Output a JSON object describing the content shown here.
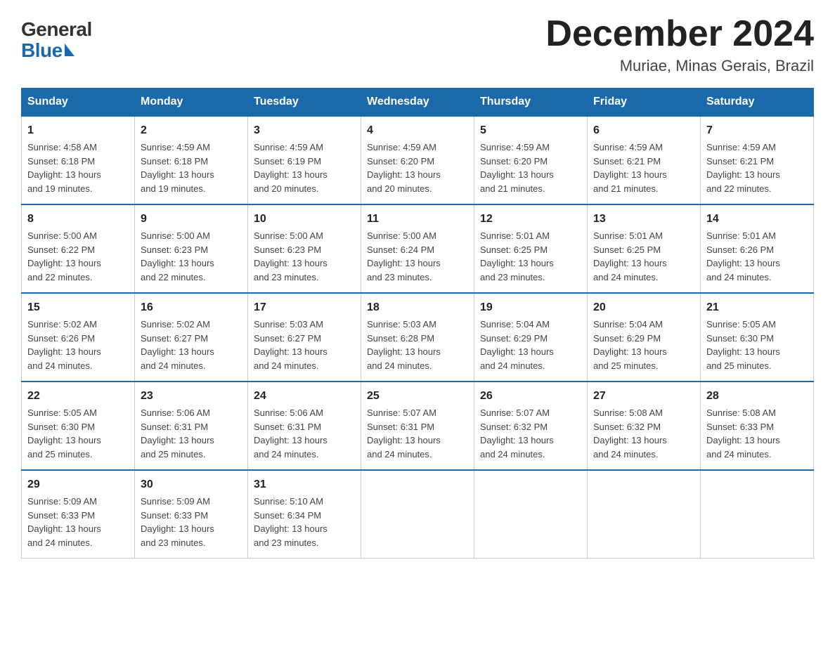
{
  "logo": {
    "general": "General",
    "blue": "Blue"
  },
  "title": "December 2024",
  "subtitle": "Muriae, Minas Gerais, Brazil",
  "days_of_week": [
    "Sunday",
    "Monday",
    "Tuesday",
    "Wednesday",
    "Thursday",
    "Friday",
    "Saturday"
  ],
  "weeks": [
    [
      {
        "day": "1",
        "sunrise": "4:58 AM",
        "sunset": "6:18 PM",
        "daylight": "13 hours and 19 minutes."
      },
      {
        "day": "2",
        "sunrise": "4:59 AM",
        "sunset": "6:18 PM",
        "daylight": "13 hours and 19 minutes."
      },
      {
        "day": "3",
        "sunrise": "4:59 AM",
        "sunset": "6:19 PM",
        "daylight": "13 hours and 20 minutes."
      },
      {
        "day": "4",
        "sunrise": "4:59 AM",
        "sunset": "6:20 PM",
        "daylight": "13 hours and 20 minutes."
      },
      {
        "day": "5",
        "sunrise": "4:59 AM",
        "sunset": "6:20 PM",
        "daylight": "13 hours and 21 minutes."
      },
      {
        "day": "6",
        "sunrise": "4:59 AM",
        "sunset": "6:21 PM",
        "daylight": "13 hours and 21 minutes."
      },
      {
        "day": "7",
        "sunrise": "4:59 AM",
        "sunset": "6:21 PM",
        "daylight": "13 hours and 22 minutes."
      }
    ],
    [
      {
        "day": "8",
        "sunrise": "5:00 AM",
        "sunset": "6:22 PM",
        "daylight": "13 hours and 22 minutes."
      },
      {
        "day": "9",
        "sunrise": "5:00 AM",
        "sunset": "6:23 PM",
        "daylight": "13 hours and 22 minutes."
      },
      {
        "day": "10",
        "sunrise": "5:00 AM",
        "sunset": "6:23 PM",
        "daylight": "13 hours and 23 minutes."
      },
      {
        "day": "11",
        "sunrise": "5:00 AM",
        "sunset": "6:24 PM",
        "daylight": "13 hours and 23 minutes."
      },
      {
        "day": "12",
        "sunrise": "5:01 AM",
        "sunset": "6:25 PM",
        "daylight": "13 hours and 23 minutes."
      },
      {
        "day": "13",
        "sunrise": "5:01 AM",
        "sunset": "6:25 PM",
        "daylight": "13 hours and 24 minutes."
      },
      {
        "day": "14",
        "sunrise": "5:01 AM",
        "sunset": "6:26 PM",
        "daylight": "13 hours and 24 minutes."
      }
    ],
    [
      {
        "day": "15",
        "sunrise": "5:02 AM",
        "sunset": "6:26 PM",
        "daylight": "13 hours and 24 minutes."
      },
      {
        "day": "16",
        "sunrise": "5:02 AM",
        "sunset": "6:27 PM",
        "daylight": "13 hours and 24 minutes."
      },
      {
        "day": "17",
        "sunrise": "5:03 AM",
        "sunset": "6:27 PM",
        "daylight": "13 hours and 24 minutes."
      },
      {
        "day": "18",
        "sunrise": "5:03 AM",
        "sunset": "6:28 PM",
        "daylight": "13 hours and 24 minutes."
      },
      {
        "day": "19",
        "sunrise": "5:04 AM",
        "sunset": "6:29 PM",
        "daylight": "13 hours and 24 minutes."
      },
      {
        "day": "20",
        "sunrise": "5:04 AM",
        "sunset": "6:29 PM",
        "daylight": "13 hours and 25 minutes."
      },
      {
        "day": "21",
        "sunrise": "5:05 AM",
        "sunset": "6:30 PM",
        "daylight": "13 hours and 25 minutes."
      }
    ],
    [
      {
        "day": "22",
        "sunrise": "5:05 AM",
        "sunset": "6:30 PM",
        "daylight": "13 hours and 25 minutes."
      },
      {
        "day": "23",
        "sunrise": "5:06 AM",
        "sunset": "6:31 PM",
        "daylight": "13 hours and 25 minutes."
      },
      {
        "day": "24",
        "sunrise": "5:06 AM",
        "sunset": "6:31 PM",
        "daylight": "13 hours and 24 minutes."
      },
      {
        "day": "25",
        "sunrise": "5:07 AM",
        "sunset": "6:31 PM",
        "daylight": "13 hours and 24 minutes."
      },
      {
        "day": "26",
        "sunrise": "5:07 AM",
        "sunset": "6:32 PM",
        "daylight": "13 hours and 24 minutes."
      },
      {
        "day": "27",
        "sunrise": "5:08 AM",
        "sunset": "6:32 PM",
        "daylight": "13 hours and 24 minutes."
      },
      {
        "day": "28",
        "sunrise": "5:08 AM",
        "sunset": "6:33 PM",
        "daylight": "13 hours and 24 minutes."
      }
    ],
    [
      {
        "day": "29",
        "sunrise": "5:09 AM",
        "sunset": "6:33 PM",
        "daylight": "13 hours and 24 minutes."
      },
      {
        "day": "30",
        "sunrise": "5:09 AM",
        "sunset": "6:33 PM",
        "daylight": "13 hours and 23 minutes."
      },
      {
        "day": "31",
        "sunrise": "5:10 AM",
        "sunset": "6:34 PM",
        "daylight": "13 hours and 23 minutes."
      },
      null,
      null,
      null,
      null
    ]
  ],
  "labels": {
    "sunrise": "Sunrise:",
    "sunset": "Sunset:",
    "daylight": "Daylight:"
  }
}
